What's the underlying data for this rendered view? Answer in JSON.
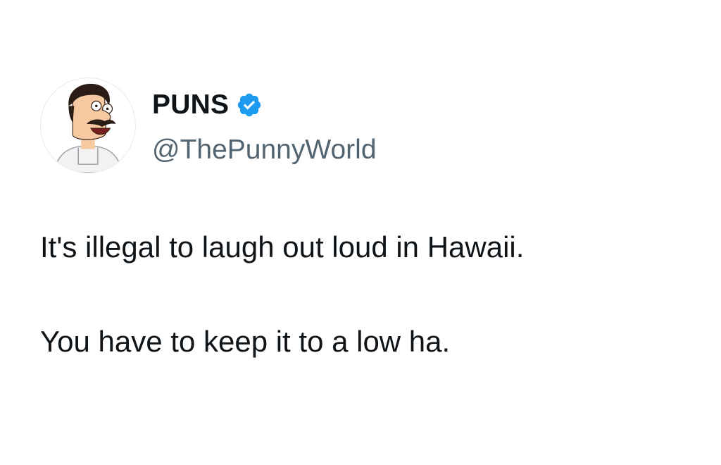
{
  "author": {
    "display_name": "PUNS",
    "handle": "@ThePunnyWorld",
    "verified_badge_icon": "verified-check-icon",
    "avatar_icon": "cartoon-avatar"
  },
  "tweet": {
    "lines": [
      "It's illegal to laugh out loud in Hawaii.",
      "You have to keep it to a low ha."
    ]
  },
  "colors": {
    "text": "#0f1419",
    "secondary_text": "#536471",
    "verified_blue": "#1d9bf0",
    "background": "#ffffff"
  }
}
